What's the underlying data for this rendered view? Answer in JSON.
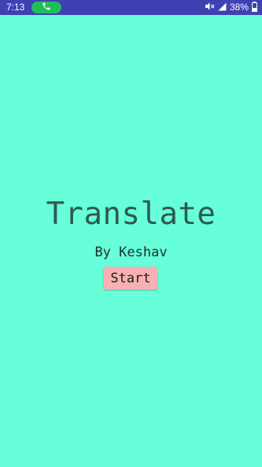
{
  "status_bar": {
    "time": "7:13",
    "battery_percent": "38%",
    "icons": [
      "call-icon",
      "mute-icon",
      "signal-icon",
      "battery-icon"
    ],
    "background_color": "#3f41b3",
    "call_pill_color": "#1fbe5a"
  },
  "main": {
    "title": "Translate",
    "subtitle": "By Keshav",
    "start_label": "Start",
    "background_color": "#66ffd9",
    "button_color": "#f8b1b3"
  }
}
